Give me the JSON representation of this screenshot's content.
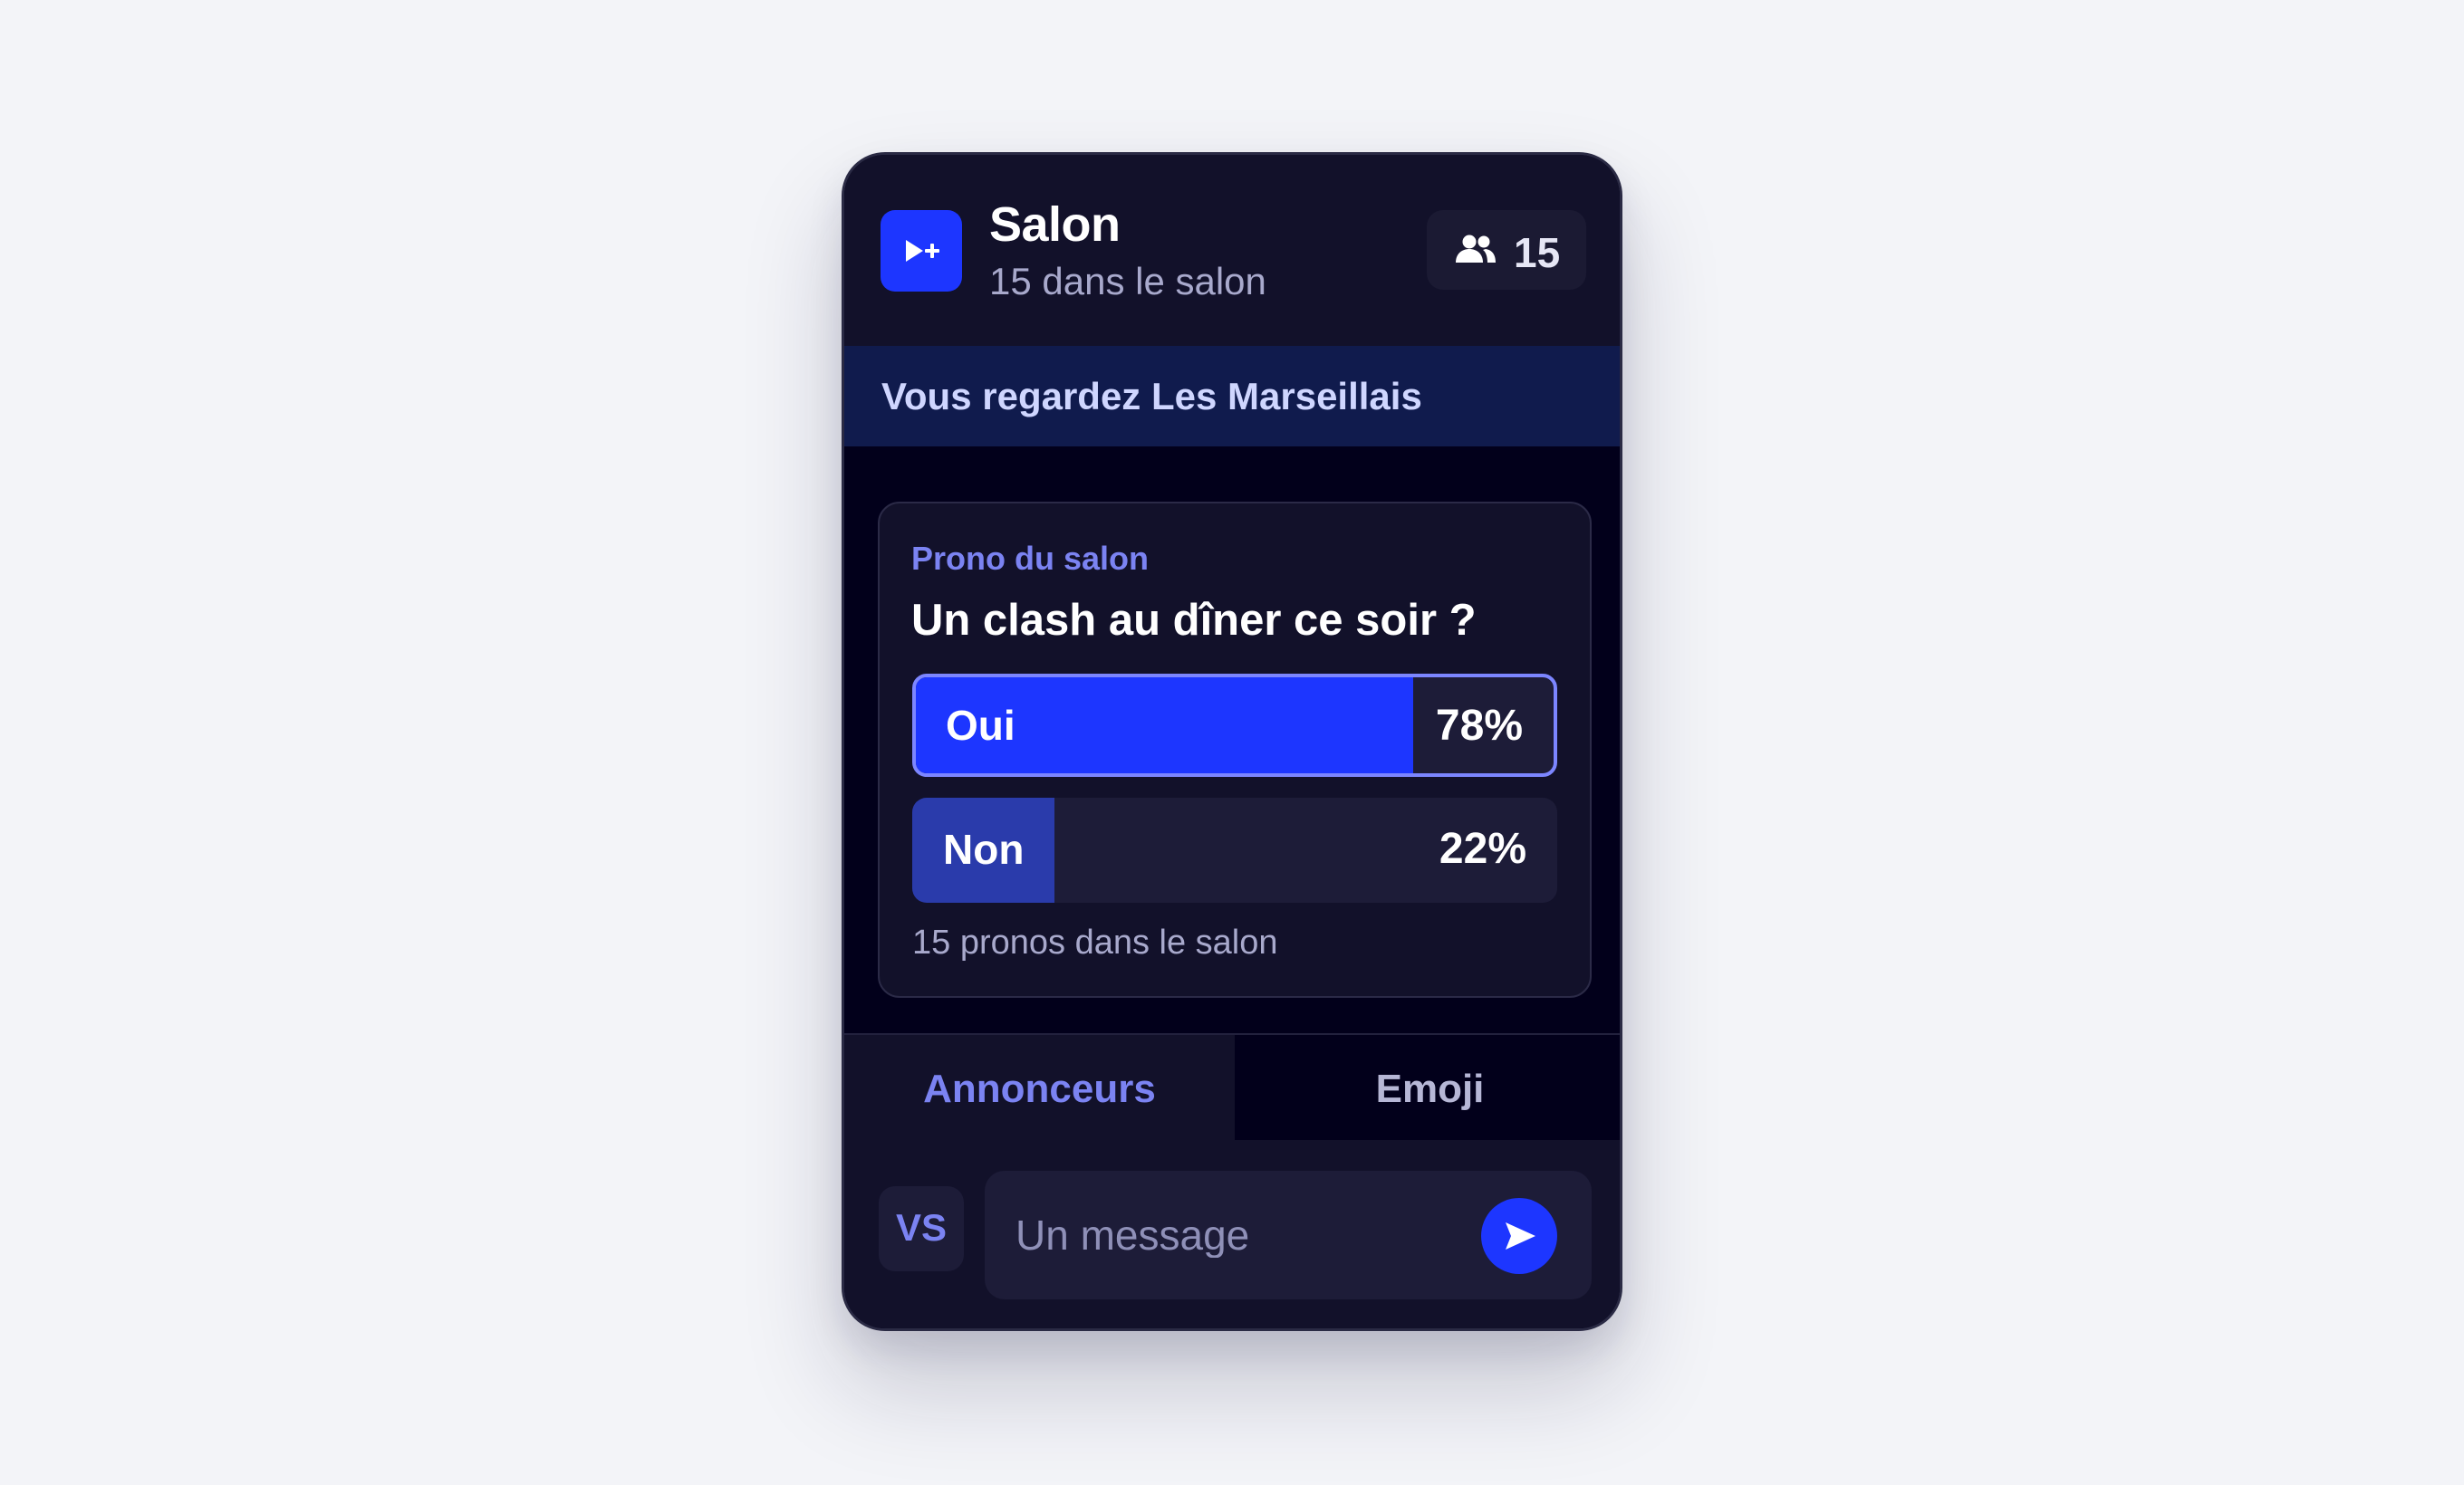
{
  "header": {
    "title": "Salon",
    "subtitle": "15 dans le salon",
    "viewer_count": "15",
    "icons": {
      "logo": "play-plus-icon",
      "viewers": "people-icon"
    }
  },
  "banner": {
    "text": "Vous regardez Les Marseillais"
  },
  "poll": {
    "label": "Prono du salon",
    "question": "Un clash au dîner ce soir ?",
    "options": [
      {
        "label": "Oui",
        "percent_text": "78%",
        "percent": 78,
        "selected": true
      },
      {
        "label": "Non",
        "percent_text": "22%",
        "percent": 22,
        "selected": false
      }
    ],
    "footer": "15 pronos dans le salon"
  },
  "tabs": [
    {
      "label": "Annonceurs",
      "active": true
    },
    {
      "label": "Emoji",
      "active": false
    }
  ],
  "composer": {
    "avatar_initials": "VS",
    "placeholder": "Un message",
    "value": "",
    "send_icon": "send-arrow-icon"
  },
  "colors": {
    "accent": "#1d36ff",
    "accent_light": "#7b83f2",
    "card_bg": "#02001b",
    "panel_bg": "#12112a",
    "banner_bg": "#101b4d",
    "page_bg": "#f3f4f8"
  }
}
